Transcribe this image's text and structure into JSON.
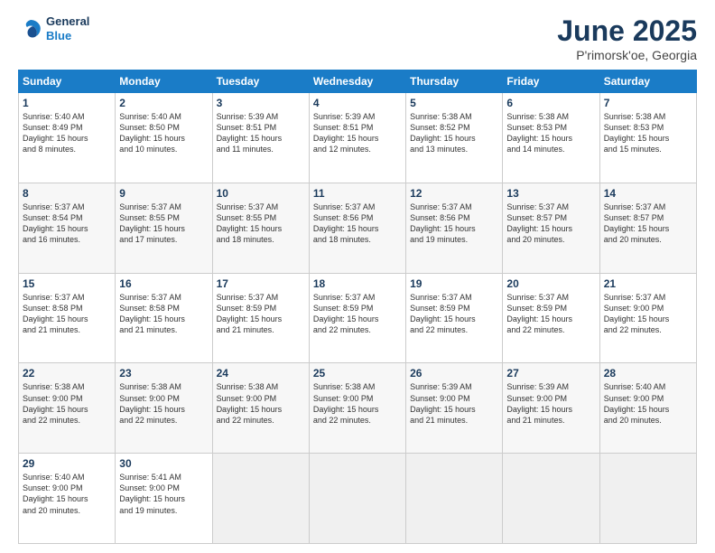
{
  "header": {
    "logo_line1": "General",
    "logo_line2": "Blue",
    "title": "June 2025",
    "location": "P'rimorsk'oe, Georgia"
  },
  "weekdays": [
    "Sunday",
    "Monday",
    "Tuesday",
    "Wednesday",
    "Thursday",
    "Friday",
    "Saturday"
  ],
  "weeks": [
    [
      {
        "day": "1",
        "info": "Sunrise: 5:40 AM\nSunset: 8:49 PM\nDaylight: 15 hours\nand 8 minutes."
      },
      {
        "day": "2",
        "info": "Sunrise: 5:40 AM\nSunset: 8:50 PM\nDaylight: 15 hours\nand 10 minutes."
      },
      {
        "day": "3",
        "info": "Sunrise: 5:39 AM\nSunset: 8:51 PM\nDaylight: 15 hours\nand 11 minutes."
      },
      {
        "day": "4",
        "info": "Sunrise: 5:39 AM\nSunset: 8:51 PM\nDaylight: 15 hours\nand 12 minutes."
      },
      {
        "day": "5",
        "info": "Sunrise: 5:38 AM\nSunset: 8:52 PM\nDaylight: 15 hours\nand 13 minutes."
      },
      {
        "day": "6",
        "info": "Sunrise: 5:38 AM\nSunset: 8:53 PM\nDaylight: 15 hours\nand 14 minutes."
      },
      {
        "day": "7",
        "info": "Sunrise: 5:38 AM\nSunset: 8:53 PM\nDaylight: 15 hours\nand 15 minutes."
      }
    ],
    [
      {
        "day": "8",
        "info": "Sunrise: 5:37 AM\nSunset: 8:54 PM\nDaylight: 15 hours\nand 16 minutes."
      },
      {
        "day": "9",
        "info": "Sunrise: 5:37 AM\nSunset: 8:55 PM\nDaylight: 15 hours\nand 17 minutes."
      },
      {
        "day": "10",
        "info": "Sunrise: 5:37 AM\nSunset: 8:55 PM\nDaylight: 15 hours\nand 18 minutes."
      },
      {
        "day": "11",
        "info": "Sunrise: 5:37 AM\nSunset: 8:56 PM\nDaylight: 15 hours\nand 18 minutes."
      },
      {
        "day": "12",
        "info": "Sunrise: 5:37 AM\nSunset: 8:56 PM\nDaylight: 15 hours\nand 19 minutes."
      },
      {
        "day": "13",
        "info": "Sunrise: 5:37 AM\nSunset: 8:57 PM\nDaylight: 15 hours\nand 20 minutes."
      },
      {
        "day": "14",
        "info": "Sunrise: 5:37 AM\nSunset: 8:57 PM\nDaylight: 15 hours\nand 20 minutes."
      }
    ],
    [
      {
        "day": "15",
        "info": "Sunrise: 5:37 AM\nSunset: 8:58 PM\nDaylight: 15 hours\nand 21 minutes."
      },
      {
        "day": "16",
        "info": "Sunrise: 5:37 AM\nSunset: 8:58 PM\nDaylight: 15 hours\nand 21 minutes."
      },
      {
        "day": "17",
        "info": "Sunrise: 5:37 AM\nSunset: 8:59 PM\nDaylight: 15 hours\nand 21 minutes."
      },
      {
        "day": "18",
        "info": "Sunrise: 5:37 AM\nSunset: 8:59 PM\nDaylight: 15 hours\nand 22 minutes."
      },
      {
        "day": "19",
        "info": "Sunrise: 5:37 AM\nSunset: 8:59 PM\nDaylight: 15 hours\nand 22 minutes."
      },
      {
        "day": "20",
        "info": "Sunrise: 5:37 AM\nSunset: 8:59 PM\nDaylight: 15 hours\nand 22 minutes."
      },
      {
        "day": "21",
        "info": "Sunrise: 5:37 AM\nSunset: 9:00 PM\nDaylight: 15 hours\nand 22 minutes."
      }
    ],
    [
      {
        "day": "22",
        "info": "Sunrise: 5:38 AM\nSunset: 9:00 PM\nDaylight: 15 hours\nand 22 minutes."
      },
      {
        "day": "23",
        "info": "Sunrise: 5:38 AM\nSunset: 9:00 PM\nDaylight: 15 hours\nand 22 minutes."
      },
      {
        "day": "24",
        "info": "Sunrise: 5:38 AM\nSunset: 9:00 PM\nDaylight: 15 hours\nand 22 minutes."
      },
      {
        "day": "25",
        "info": "Sunrise: 5:38 AM\nSunset: 9:00 PM\nDaylight: 15 hours\nand 22 minutes."
      },
      {
        "day": "26",
        "info": "Sunrise: 5:39 AM\nSunset: 9:00 PM\nDaylight: 15 hours\nand 21 minutes."
      },
      {
        "day": "27",
        "info": "Sunrise: 5:39 AM\nSunset: 9:00 PM\nDaylight: 15 hours\nand 21 minutes."
      },
      {
        "day": "28",
        "info": "Sunrise: 5:40 AM\nSunset: 9:00 PM\nDaylight: 15 hours\nand 20 minutes."
      }
    ],
    [
      {
        "day": "29",
        "info": "Sunrise: 5:40 AM\nSunset: 9:00 PM\nDaylight: 15 hours\nand 20 minutes."
      },
      {
        "day": "30",
        "info": "Sunrise: 5:41 AM\nSunset: 9:00 PM\nDaylight: 15 hours\nand 19 minutes."
      },
      {
        "day": "",
        "info": ""
      },
      {
        "day": "",
        "info": ""
      },
      {
        "day": "",
        "info": ""
      },
      {
        "day": "",
        "info": ""
      },
      {
        "day": "",
        "info": ""
      }
    ]
  ]
}
